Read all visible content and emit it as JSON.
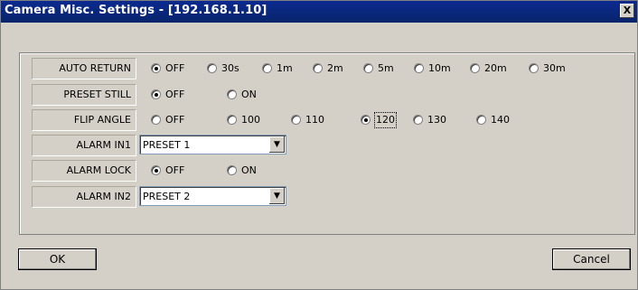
{
  "window": {
    "title": "Camera Misc. Settings - [192.168.1.10]",
    "close_label": "X"
  },
  "rows": [
    {
      "label": "AUTO RETURN",
      "options": [
        "OFF",
        "30s",
        "1m",
        "2m",
        "5m",
        "10m",
        "20m",
        "30m"
      ],
      "selected": 0
    },
    {
      "label": "PRESET STILL",
      "options": [
        "OFF",
        "ON"
      ],
      "selected": 0
    },
    {
      "label": "FLIP ANGLE",
      "options": [
        "OFF",
        "100",
        "110",
        "120",
        "130",
        "140"
      ],
      "selected": 3
    },
    {
      "label": "ALARM IN1",
      "select_value": "PRESET 1"
    },
    {
      "label": "ALARM LOCK",
      "options": [
        "OFF",
        "ON"
      ],
      "selected": 0
    },
    {
      "label": "ALARM IN2",
      "select_value": "PRESET 2"
    }
  ],
  "buttons": {
    "ok": "OK",
    "cancel": "Cancel"
  }
}
